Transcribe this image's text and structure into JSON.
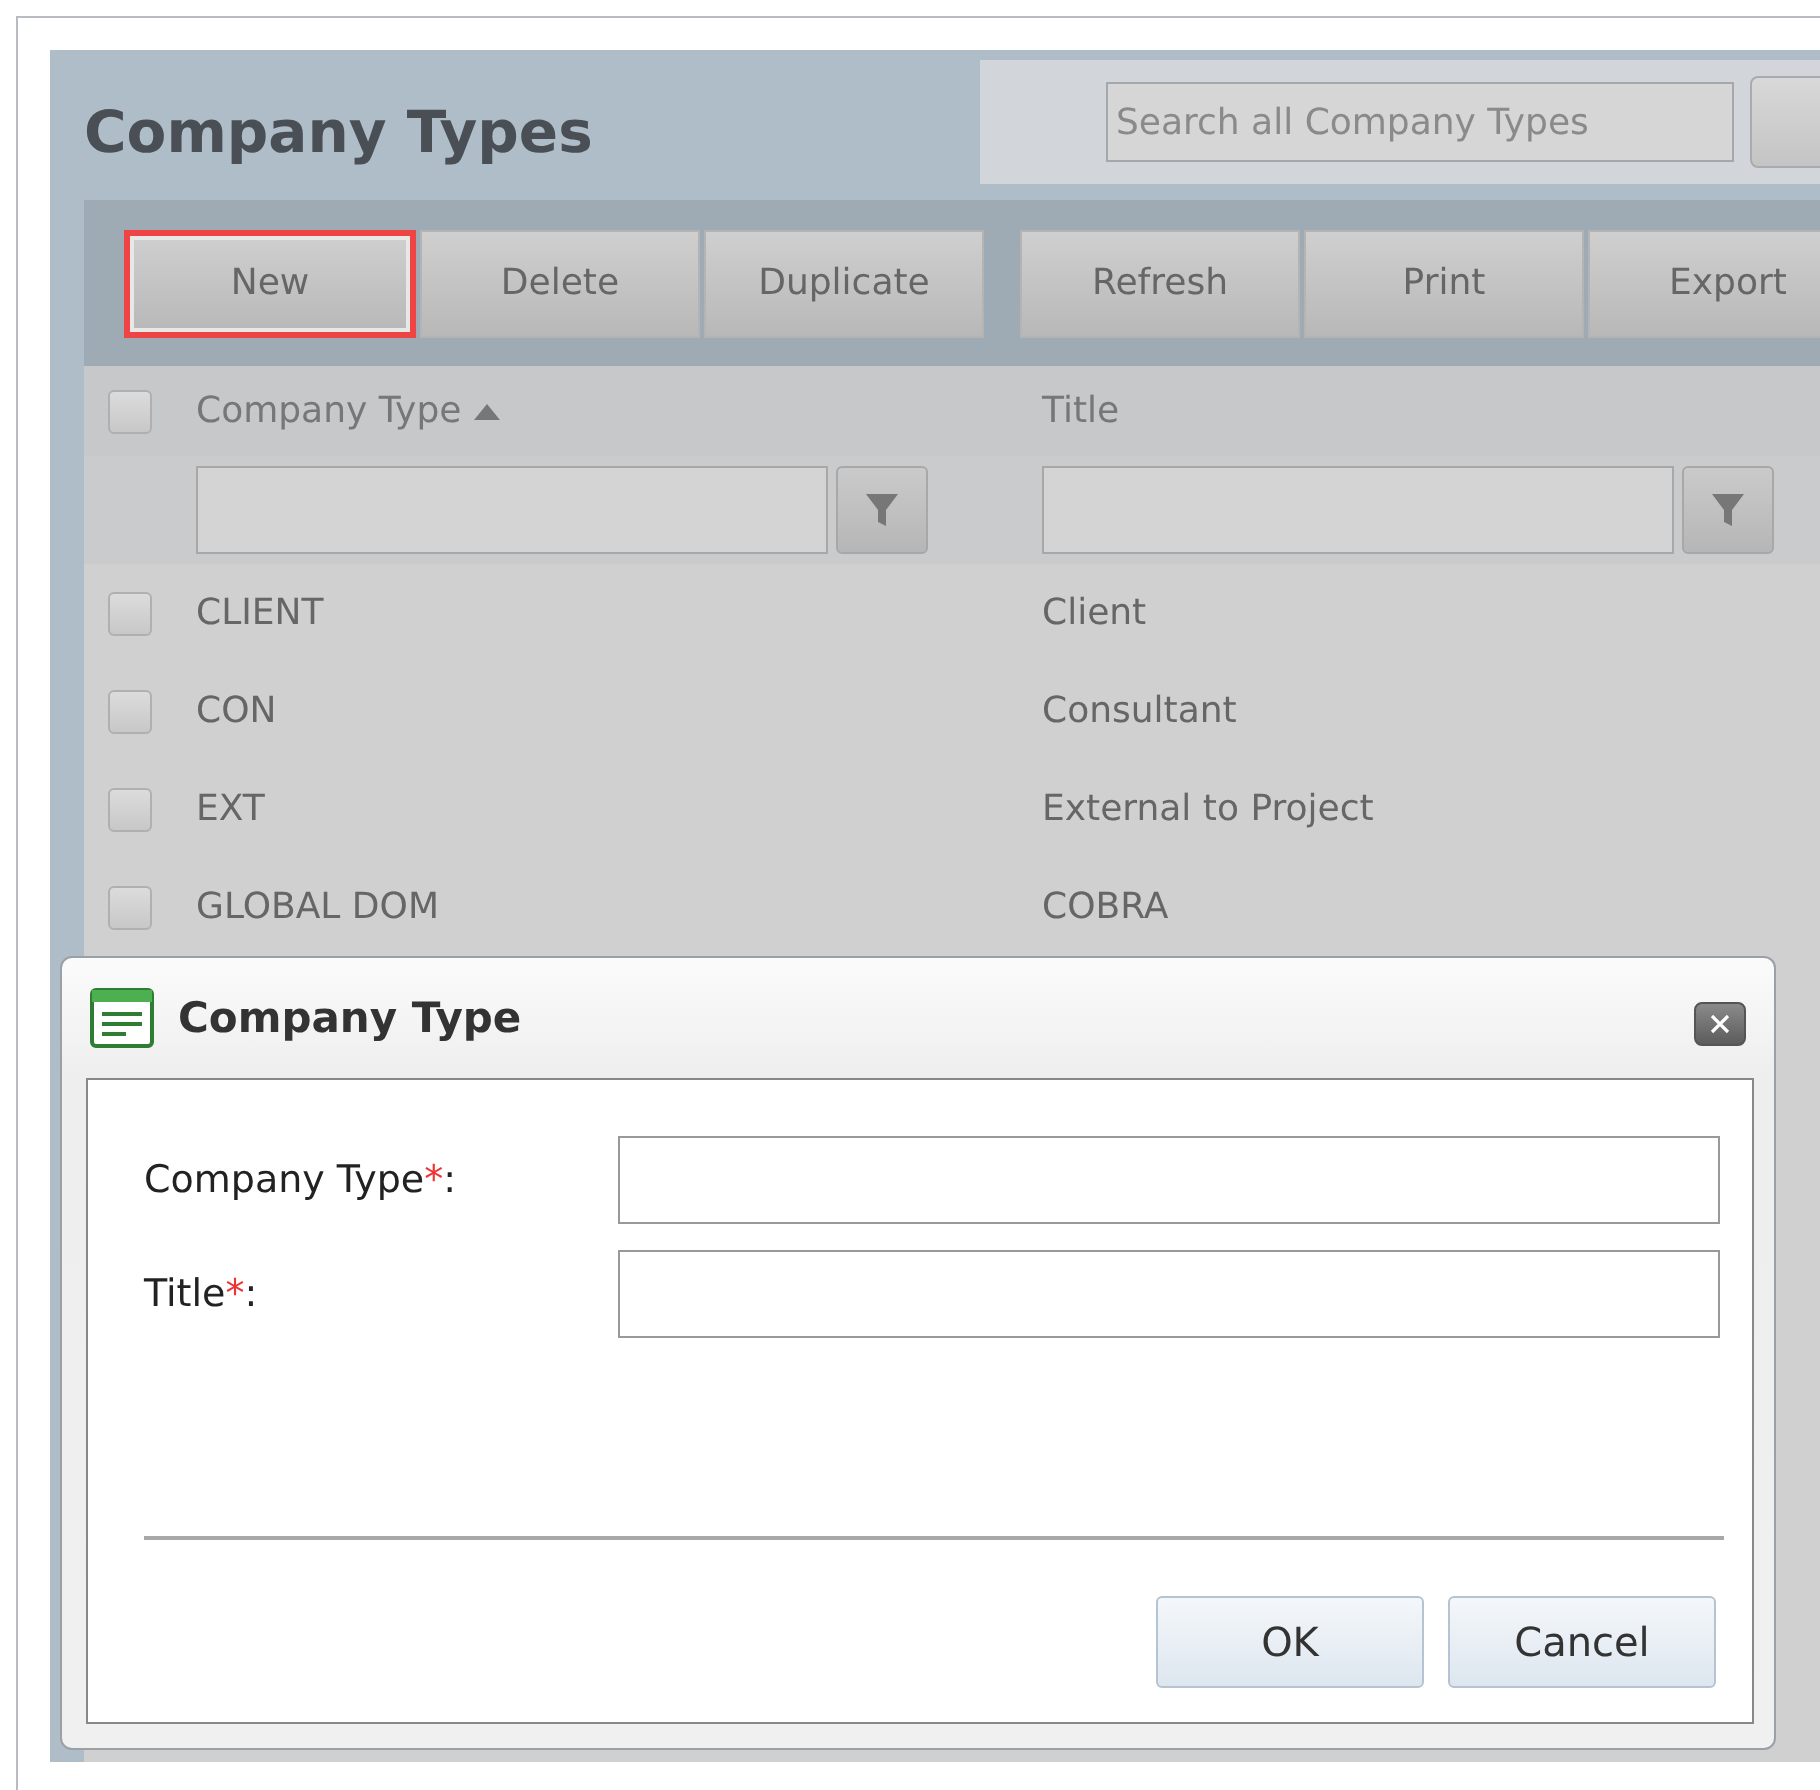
{
  "page": {
    "title": "Company Types",
    "search": {
      "placeholder": "Search all Company Types"
    }
  },
  "toolbar": {
    "groups": [
      [
        {
          "label": "New",
          "highlighted": true
        },
        {
          "label": "Delete",
          "highlighted": false
        },
        {
          "label": "Duplicate",
          "highlighted": false
        }
      ],
      [
        {
          "label": "Refresh",
          "highlighted": false
        },
        {
          "label": "Print",
          "highlighted": false
        },
        {
          "label": "Export",
          "highlighted": false
        }
      ]
    ]
  },
  "table": {
    "header_checked": false,
    "columns": [
      {
        "label": "Company Type",
        "sorted": true
      },
      {
        "label": "Title",
        "sorted": false
      }
    ],
    "rows": [
      {
        "checked": false,
        "cells": [
          "CLIENT",
          "Client"
        ]
      },
      {
        "checked": false,
        "cells": [
          "CON",
          "Consultant"
        ]
      },
      {
        "checked": false,
        "cells": [
          "EXT",
          "External to Project"
        ]
      },
      {
        "checked": false,
        "cells": [
          "GLOBAL DOM",
          "COBRA"
        ]
      }
    ]
  },
  "dialog": {
    "title": "Company Type",
    "fields": [
      {
        "label": "Company Type",
        "required_mark": "*",
        "separator": ":"
      },
      {
        "label": "Title",
        "required_mark": "*",
        "separator": ":"
      }
    ],
    "buttons": [
      "OK",
      "Cancel"
    ]
  }
}
